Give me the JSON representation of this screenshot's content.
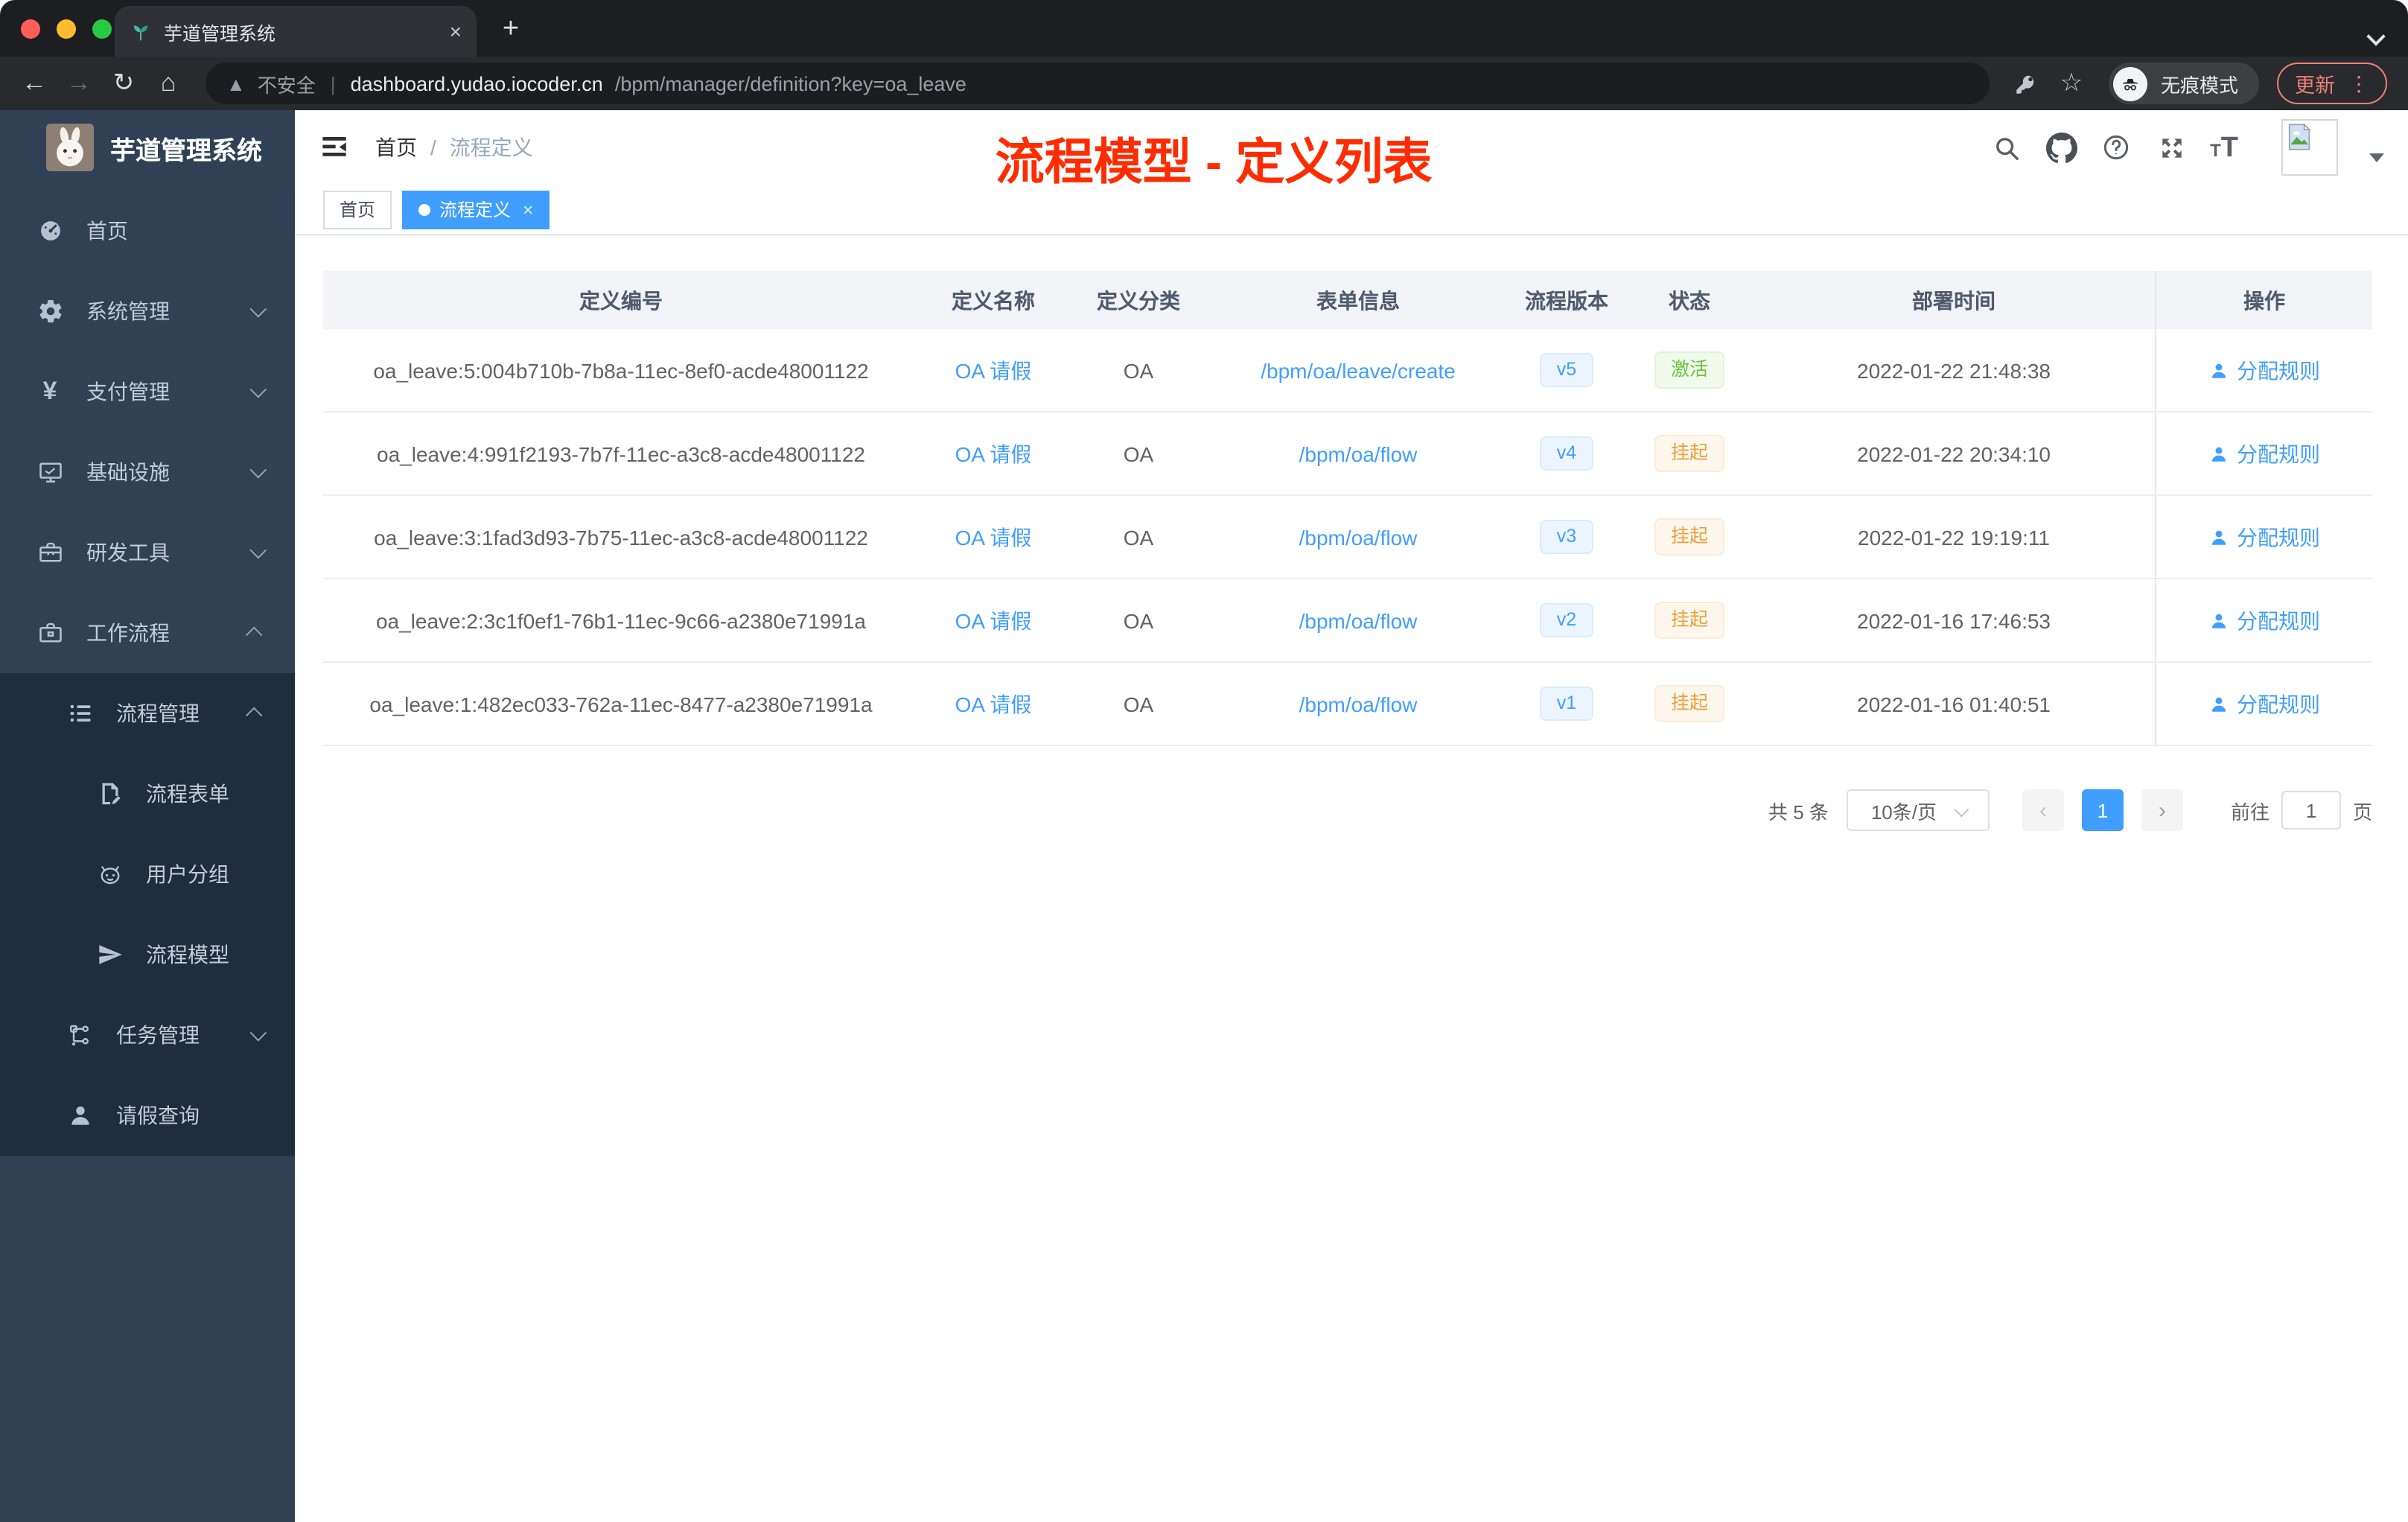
{
  "colors": {
    "accent": "#409eff",
    "annotation_red": "#fe2c00",
    "sidebar_bg": "#304156",
    "submenu_bg": "#1f2d3d",
    "warning": "#e6a23c",
    "success": "#67c23a"
  },
  "browser": {
    "tab_title": "芋道管理系统",
    "new_tab_label": "+",
    "close_label": "×",
    "security_label": "不安全",
    "url_host": "dashboard.yudao.iocoder.cn",
    "url_path": "/bpm/manager/definition?key=oa_leave",
    "incognito_label": "无痕模式",
    "update_label": "更新",
    "kebab": "⋮",
    "back": "←",
    "forward": "→",
    "reload": "↻",
    "home": "⌂",
    "star": "☆"
  },
  "sidebar": {
    "logo_title": "芋道管理系统",
    "menu": [
      {
        "id": "home",
        "label": "首页",
        "icon": "dashboard-icon",
        "level": 1,
        "dark": false
      },
      {
        "id": "system",
        "label": "系统管理",
        "icon": "gear-icon",
        "level": 1,
        "dark": false,
        "chevron": "down"
      },
      {
        "id": "payment",
        "label": "支付管理",
        "icon": "yen-icon",
        "level": 1,
        "dark": false,
        "chevron": "down"
      },
      {
        "id": "infra",
        "label": "基础设施",
        "icon": "monitor-icon",
        "level": 1,
        "dark": false,
        "chevron": "down"
      },
      {
        "id": "devtools",
        "label": "研发工具",
        "icon": "toolbox-icon",
        "level": 1,
        "dark": false,
        "chevron": "down"
      },
      {
        "id": "workflow",
        "label": "工作流程",
        "icon": "briefcase-icon",
        "level": 1,
        "dark": false,
        "chevron": "up"
      },
      {
        "id": "process-mgmt",
        "label": "流程管理",
        "icon": "list-icon",
        "level": 2,
        "dark": true,
        "chevron": "up"
      },
      {
        "id": "process-form",
        "label": "流程表单",
        "icon": "form-icon",
        "level": 3,
        "dark": true
      },
      {
        "id": "user-group",
        "label": "用户分组",
        "icon": "robot-icon",
        "level": 3,
        "dark": true
      },
      {
        "id": "process-model",
        "label": "流程模型",
        "icon": "paper-plane-icon",
        "level": 3,
        "dark": true
      },
      {
        "id": "task-mgmt",
        "label": "任务管理",
        "icon": "tree-icon",
        "level": 2,
        "dark": true,
        "chevron": "down"
      },
      {
        "id": "leave-query",
        "label": "请假查询",
        "icon": "user-icon",
        "level": 2,
        "dark": true
      }
    ]
  },
  "header": {
    "breadcrumb": [
      "首页",
      "流程定义"
    ],
    "breadcrumb_sep": "/",
    "annotation": "流程模型 - 定义列表"
  },
  "tags": {
    "inactive": "首页",
    "active": "流程定义",
    "active_close": "×"
  },
  "table": {
    "columns": [
      {
        "key": "id",
        "label": "定义编号"
      },
      {
        "key": "name",
        "label": "定义名称"
      },
      {
        "key": "category",
        "label": "定义分类"
      },
      {
        "key": "form",
        "label": "表单信息"
      },
      {
        "key": "version",
        "label": "流程版本"
      },
      {
        "key": "status",
        "label": "状态"
      },
      {
        "key": "deploy_time",
        "label": "部署时间"
      },
      {
        "key": "ops",
        "label": "操作"
      }
    ],
    "rows": [
      {
        "id": "oa_leave:5:004b710b-7b8a-11ec-8ef0-acde48001122",
        "name": "OA 请假",
        "category": "OA",
        "form": "/bpm/oa/leave/create",
        "version": "v5",
        "status": "激活",
        "status_type": "success",
        "deploy_time": "2022-01-22 21:48:38",
        "op": "分配规则"
      },
      {
        "id": "oa_leave:4:991f2193-7b7f-11ec-a3c8-acde48001122",
        "name": "OA 请假",
        "category": "OA",
        "form": "/bpm/oa/flow",
        "version": "v4",
        "status": "挂起",
        "status_type": "warning",
        "deploy_time": "2022-01-22 20:34:10",
        "op": "分配规则"
      },
      {
        "id": "oa_leave:3:1fad3d93-7b75-11ec-a3c8-acde48001122",
        "name": "OA 请假",
        "category": "OA",
        "form": "/bpm/oa/flow",
        "version": "v3",
        "status": "挂起",
        "status_type": "warning",
        "deploy_time": "2022-01-22 19:19:11",
        "op": "分配规则"
      },
      {
        "id": "oa_leave:2:3c1f0ef1-76b1-11ec-9c66-a2380e71991a",
        "name": "OA 请假",
        "category": "OA",
        "form": "/bpm/oa/flow",
        "version": "v2",
        "status": "挂起",
        "status_type": "warning",
        "deploy_time": "2022-01-16 17:46:53",
        "op": "分配规则"
      },
      {
        "id": "oa_leave:1:482ec033-762a-11ec-8477-a2380e71991a",
        "name": "OA 请假",
        "category": "OA",
        "form": "/bpm/oa/flow",
        "version": "v1",
        "status": "挂起",
        "status_type": "warning",
        "deploy_time": "2022-01-16 01:40:51",
        "op": "分配规则"
      }
    ]
  },
  "pagination": {
    "total_label": "共 5 条",
    "page_size_label": "10条/页",
    "prev": "‹",
    "next": "›",
    "current_page": "1",
    "goto_label": "前往",
    "goto_value": "1",
    "page_unit": "页"
  }
}
